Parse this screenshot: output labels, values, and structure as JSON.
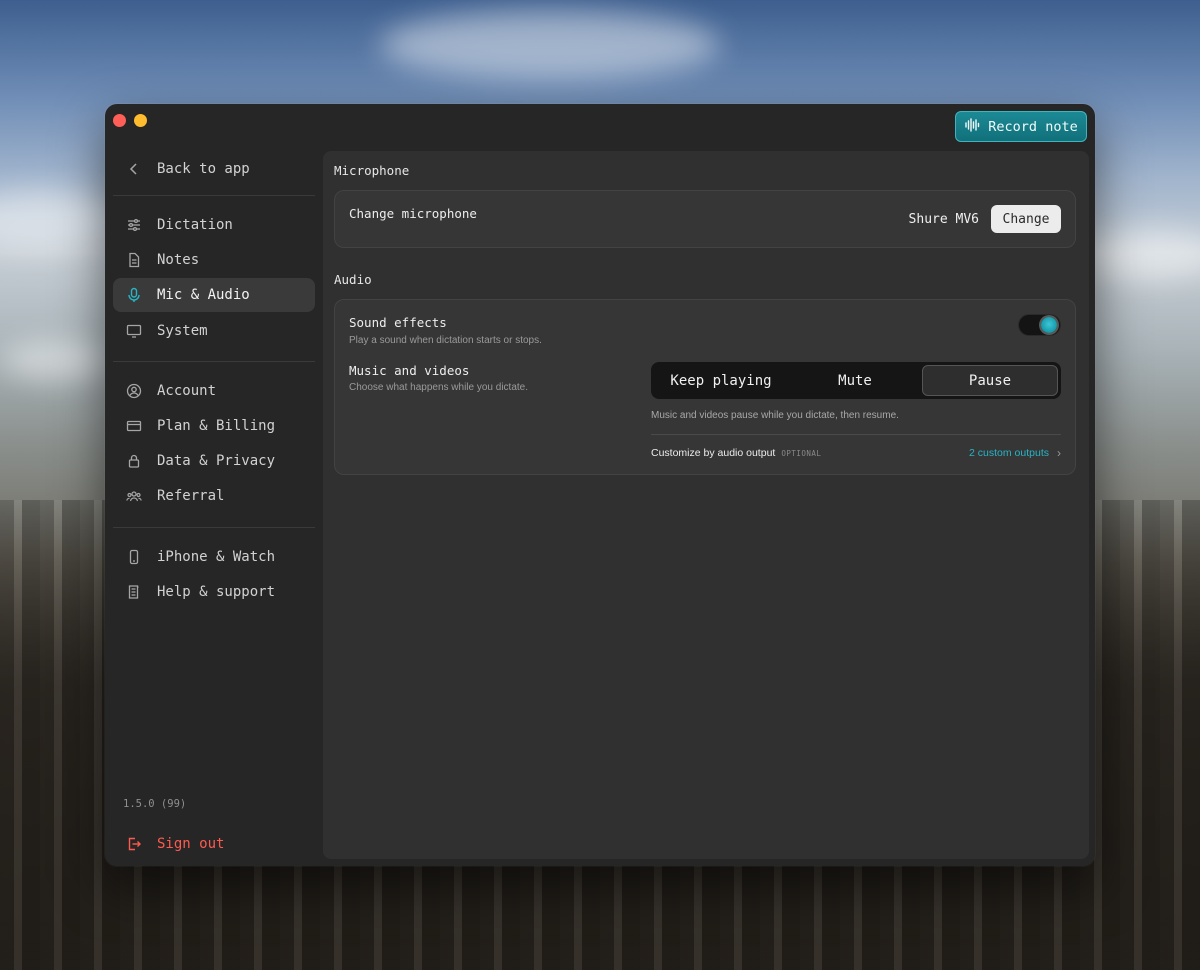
{
  "window": {
    "record_button_label": "Record note"
  },
  "sidebar": {
    "back_label": "Back to app",
    "items": [
      {
        "label": "Dictation",
        "icon": "sliders-icon"
      },
      {
        "label": "Notes",
        "icon": "document-icon"
      },
      {
        "label": "Mic & Audio",
        "icon": "microphone-icon",
        "active": true
      },
      {
        "label": "System",
        "icon": "monitor-icon"
      },
      {
        "label": "Account",
        "icon": "user-circle-icon"
      },
      {
        "label": "Plan & Billing",
        "icon": "credit-card-icon"
      },
      {
        "label": "Data & Privacy",
        "icon": "lock-icon"
      },
      {
        "label": "Referral",
        "icon": "users-icon"
      },
      {
        "label": "iPhone & Watch",
        "icon": "phone-icon"
      },
      {
        "label": "Help & support",
        "icon": "book-icon"
      }
    ],
    "version": "1.5.0 (99)",
    "sign_out_label": "Sign out"
  },
  "main": {
    "microphone": {
      "section_title": "Microphone",
      "change_label": "Change microphone",
      "current_device": "Shure MV6",
      "change_button": "Change"
    },
    "audio": {
      "section_title": "Audio",
      "sound_effects": {
        "label": "Sound effects",
        "description": "Play a sound when dictation starts or stops.",
        "enabled": true
      },
      "music_videos": {
        "label": "Music and videos",
        "description": "Choose what happens while you dictate.",
        "options": [
          "Keep playing",
          "Mute",
          "Pause"
        ],
        "selected": "Pause",
        "note": "Music and videos pause while you dictate, then resume."
      },
      "custom_output": {
        "label": "Customize by audio output",
        "optional_tag": "OPTIONAL",
        "link": "2 custom outputs"
      }
    }
  },
  "colors": {
    "accent": "#27b4c6",
    "danger": "#ff5a4f",
    "window_bg": "#262626",
    "panel_bg": "#303030"
  }
}
